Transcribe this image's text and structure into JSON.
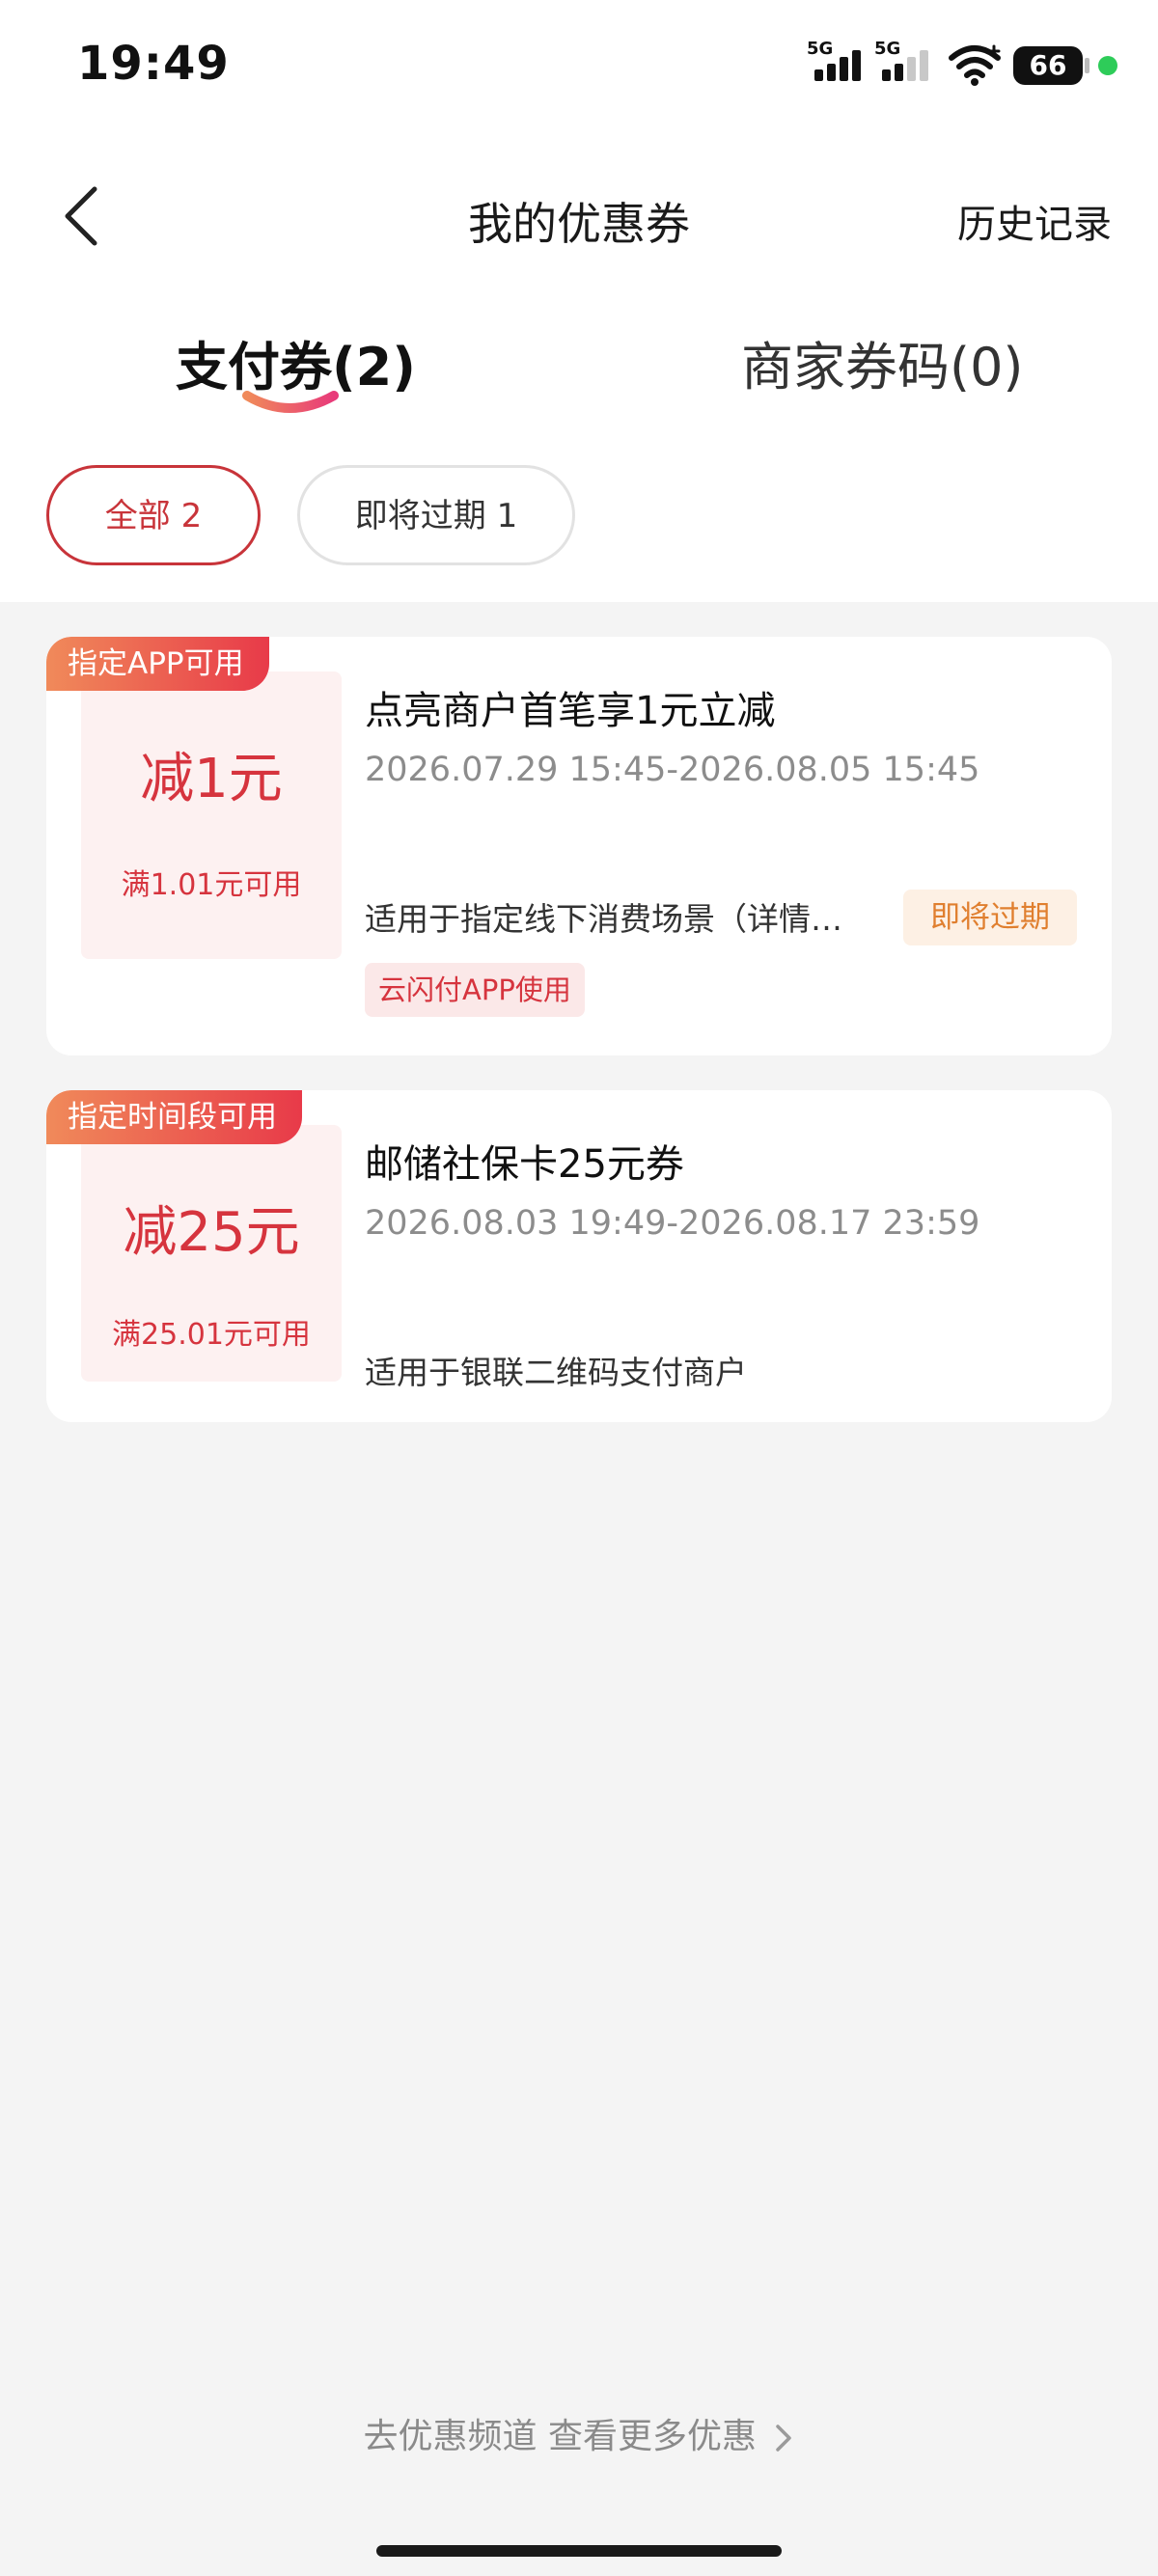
{
  "status_bar": {
    "time": "19:49",
    "signal_1_label": "5G",
    "signal_2_label": "5G",
    "wifi_icon": "wifi-icon",
    "battery": "66",
    "indicator_color": "#2ecc59"
  },
  "nav": {
    "back_icon": "chevron-left-icon",
    "title": "我的优惠券",
    "history": "历史记录"
  },
  "tabs": [
    {
      "label": "支付券(2)",
      "active": true
    },
    {
      "label": "商家券码(0)",
      "active": false
    }
  ],
  "filters": [
    {
      "label": "全部 2",
      "active": true
    },
    {
      "label": "即将过期 1",
      "active": false
    }
  ],
  "coupons": [
    {
      "tag": "指定APP可用",
      "amount": "减1元",
      "condition": "满1.01元可用",
      "title": "点亮商户首笔享1元立减",
      "validity": "2026.07.29 15:45-2026.08.05 15:45",
      "description": "适用于指定线下消费场景（详情请见使用规则）",
      "status_badge": "即将过期",
      "app_badge": "云闪付APP使用"
    },
    {
      "tag": "指定时间段可用",
      "amount": "减25元",
      "condition": "满25.01元可用",
      "title": "邮储社保卡25元券",
      "validity": "2026.08.03 19:49-2026.08.17 23:59",
      "description": "适用于银联二维码支付商户"
    }
  ],
  "footer": {
    "link": "去优惠频道 查看更多优惠",
    "chevron_icon": "chevron-right-icon"
  },
  "colors": {
    "accent": "#d6343e",
    "tag_gradient_start": "#f08a5a",
    "tag_gradient_end": "#e83a49",
    "expiring": "#e07f2f",
    "background": "#f4f4f4"
  }
}
